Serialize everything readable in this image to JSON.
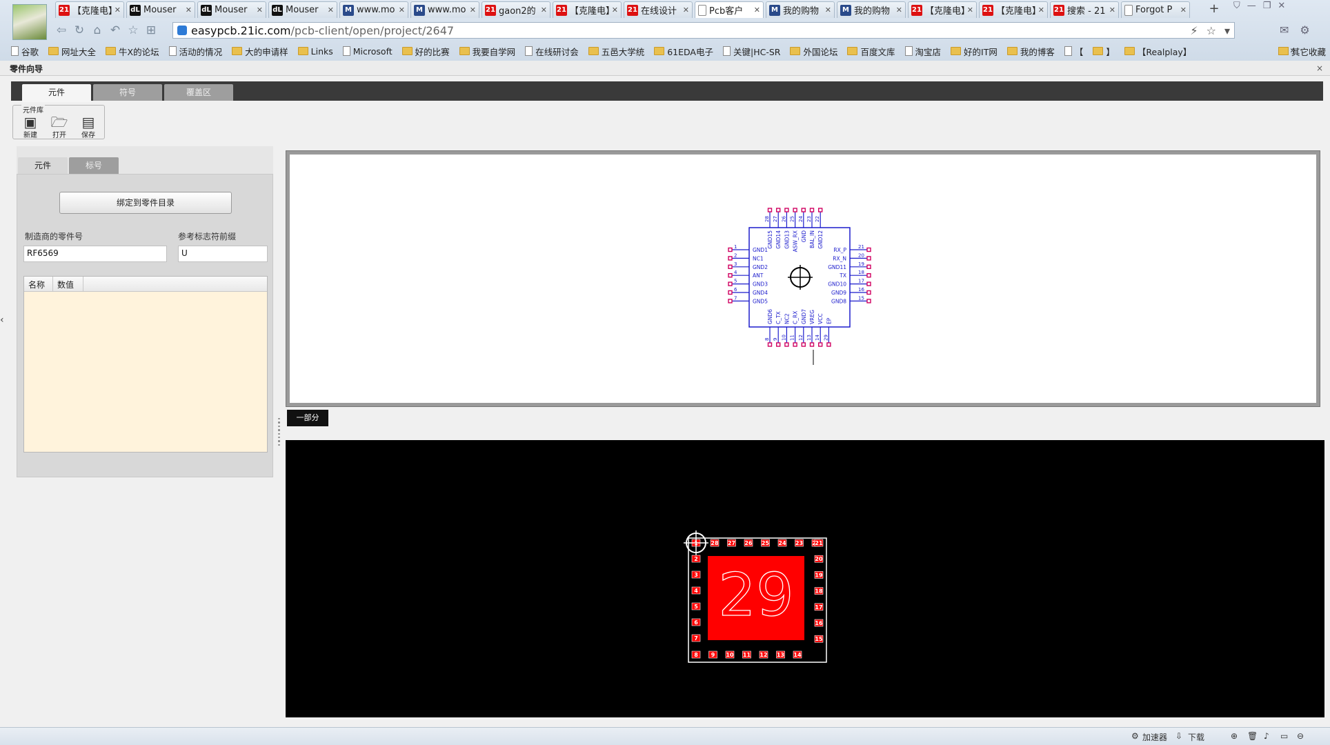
{
  "browser": {
    "tabs": [
      {
        "label": "【克隆电】",
        "fav": "21",
        "color": "#d11"
      },
      {
        "label": "Mouser",
        "fav": "dL",
        "color": "#111"
      },
      {
        "label": "Mouser",
        "fav": "dL",
        "color": "#111"
      },
      {
        "label": "Mouser",
        "fav": "dL",
        "color": "#111"
      },
      {
        "label": "www.mo",
        "fav": "M",
        "color": "#2a4a8a"
      },
      {
        "label": "www.mo",
        "fav": "M",
        "color": "#2a4a8a"
      },
      {
        "label": "gaon2的",
        "fav": "21",
        "color": "#d11"
      },
      {
        "label": "【克隆电】",
        "fav": "21",
        "color": "#d11"
      },
      {
        "label": "在线设计",
        "fav": "21",
        "color": "#d11"
      },
      {
        "label": "Pcb客户",
        "fav": "",
        "color": "#ffffff"
      },
      {
        "label": "我的购物",
        "fav": "M",
        "color": "#2a4a8a"
      },
      {
        "label": "我的购物",
        "fav": "M",
        "color": "#2a4a8a"
      },
      {
        "label": "【克隆电】",
        "fav": "21",
        "color": "#d11"
      },
      {
        "label": "【克隆电】",
        "fav": "21",
        "color": "#d11"
      },
      {
        "label": "搜索 - 21",
        "fav": "21",
        "color": "#d11"
      },
      {
        "label": "Forgot P",
        "fav": "",
        "color": "#ffffff"
      }
    ],
    "active_tab": 9,
    "new_tab": "+",
    "address_host": "easypcb.21ic.com",
    "address_path": "/pcb-client/open/project/2647",
    "bookmarks": [
      "谷歌",
      "网址大全",
      "牛X的论坛",
      "活动的情况",
      "大的申请样",
      "Links",
      "Microsoft",
      "好的比赛",
      "我要自学网",
      "在线研讨会",
      "五邑大学统",
      "61EDA电子",
      "关键|HC-SR",
      "外国论坛",
      "百度文库",
      "淘宝店",
      "好的IT网",
      "我的博客",
      "【",
      "】",
      "【Realplay】"
    ],
    "bookmarks_more": "»",
    "bookmarks_other": "其它收藏"
  },
  "app": {
    "title": "零件向导",
    "close": "×",
    "main_tabs": [
      "元件",
      "符号",
      "覆盖区"
    ],
    "toolgroup_label": "元件库",
    "tools": [
      {
        "label": "新建",
        "icon": "new-icon"
      },
      {
        "label": "打开",
        "icon": "open-folder-icon"
      },
      {
        "label": "保存",
        "icon": "save-icon"
      }
    ],
    "left_tabs": [
      "元件",
      "标号"
    ],
    "bind_button": "绑定到零件目录",
    "mfr_label": "制造商的零件号",
    "mfr_value": "RF6569",
    "ref_label": "参考标志符前缀",
    "ref_value": "U",
    "prop_columns": [
      "名称",
      "数值"
    ],
    "part_button": "一部分"
  },
  "symbol": {
    "left_pins": [
      {
        "num": "1",
        "name": "GND1"
      },
      {
        "num": "2",
        "name": "NC1"
      },
      {
        "num": "3",
        "name": "GND2"
      },
      {
        "num": "4",
        "name": "ANT"
      },
      {
        "num": "5",
        "name": "GND3"
      },
      {
        "num": "6",
        "name": "GND4"
      },
      {
        "num": "7",
        "name": "GND5"
      }
    ],
    "right_pins": [
      {
        "num": "21",
        "name": "RX_P"
      },
      {
        "num": "20",
        "name": "RX_N"
      },
      {
        "num": "19",
        "name": "GND11"
      },
      {
        "num": "18",
        "name": "TX"
      },
      {
        "num": "17",
        "name": "GND10"
      },
      {
        "num": "16",
        "name": "GND9"
      },
      {
        "num": "15",
        "name": "GND8"
      }
    ],
    "top_pins": [
      {
        "num": "28",
        "name": "GND15"
      },
      {
        "num": "27",
        "name": "GND14"
      },
      {
        "num": "26",
        "name": "GND13"
      },
      {
        "num": "25",
        "name": "ASW_RX"
      },
      {
        "num": "24",
        "name": "GND"
      },
      {
        "num": "23",
        "name": "BAL_IN"
      },
      {
        "num": "22",
        "name": "GND12"
      }
    ],
    "bottom_pins": [
      {
        "num": "8",
        "name": "GND6"
      },
      {
        "num": "9",
        "name": "C_TX"
      },
      {
        "num": "10",
        "name": "NC2"
      },
      {
        "num": "11",
        "name": "C_RX"
      },
      {
        "num": "12",
        "name": "GND7"
      },
      {
        "num": "13",
        "name": "VREG"
      },
      {
        "num": "14",
        "name": "VCC"
      },
      {
        "num": "29",
        "name": "EP"
      }
    ]
  },
  "footprint": {
    "top_pads": [
      "28",
      "27",
      "26",
      "25",
      "24",
      "23",
      "22"
    ],
    "left_pads": [
      "2",
      "3",
      "4",
      "5",
      "6",
      "7"
    ],
    "right_pads": [
      "21",
      "20",
      "19",
      "18",
      "17",
      "16",
      "15"
    ],
    "bottom_pads": [
      "8",
      "9",
      "10",
      "11",
      "12",
      "13",
      "14"
    ],
    "center_pad": "29",
    "pad_color": "#ff0000"
  },
  "status": {
    "accelerator": "加速器",
    "download": "下载"
  }
}
